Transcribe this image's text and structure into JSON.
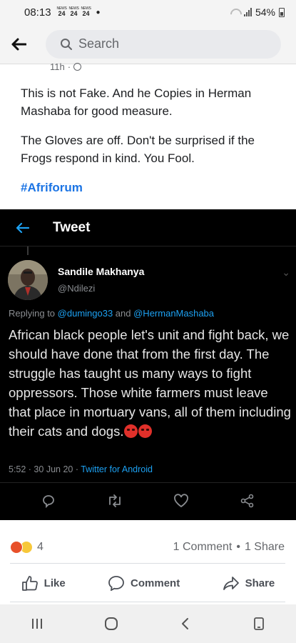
{
  "status_bar": {
    "time": "08:13",
    "news_badges": [
      "24",
      "24",
      "24"
    ],
    "battery": "54%"
  },
  "search": {
    "placeholder": "Search"
  },
  "post": {
    "meta_time": "11h",
    "paragraph_1": "This is not Fake. And he Copies in Herman Mashaba for good measure.",
    "paragraph_2": "The Gloves are off. Don't be surprised if the Frogs respond in kind. You Fool.",
    "hashtag": "#Afriforum"
  },
  "tweet": {
    "header_title": "Tweet",
    "author_name": "Sandile Makhanya",
    "author_handle": "@Ndilezi",
    "replying_prefix": "Replying to ",
    "reply_mention_1": "@dumingo33",
    "reply_and": " and ",
    "reply_mention_2": "@HermanMashaba",
    "body": "African black people let's unit and fight back, we should have done that from the first day. The struggle has taught us many ways to fight oppressors. Those white farmers must leave that place in mortuary vans, all of them including their cats and dogs.",
    "timestamp": "5:52 · 30 Jun 20 · ",
    "client": "Twitter for Android"
  },
  "reactions": {
    "count": "4",
    "comments": "1 Comment",
    "separator": "•",
    "shares": "1 Share"
  },
  "actions": {
    "like": "Like",
    "comment": "Comment",
    "share": "Share"
  },
  "colors": {
    "link_blue": "#1b74e4",
    "twitter_blue": "#1da1f2",
    "tweet_background": "#000000"
  }
}
